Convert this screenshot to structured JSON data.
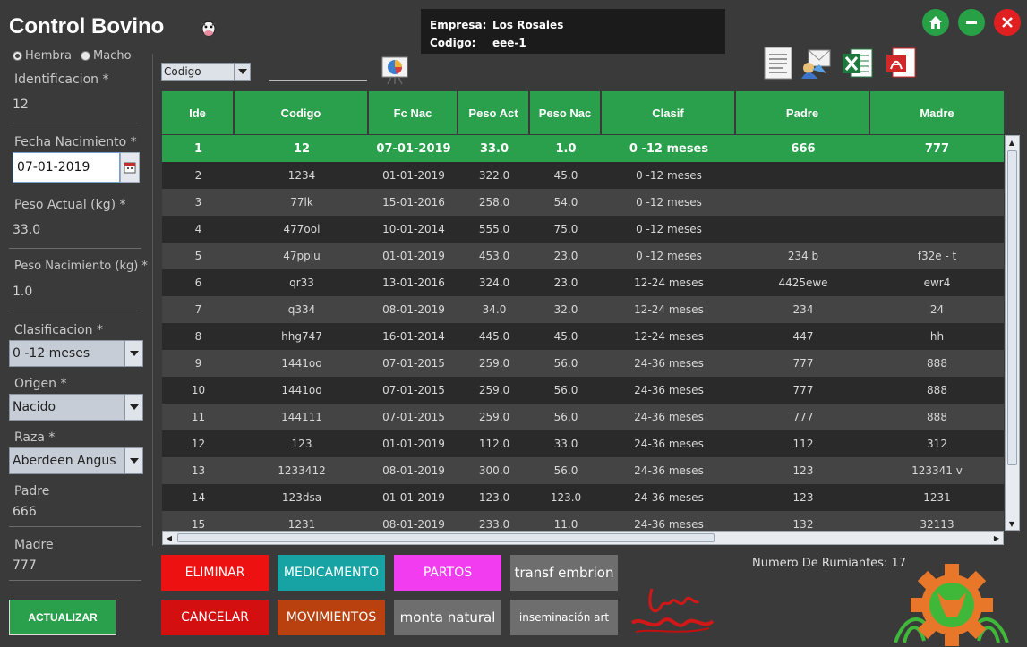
{
  "app": {
    "title": "Control Bovino"
  },
  "company": {
    "empresa_label": "Empresa:",
    "empresa_value": "Los Rosales",
    "codigo_label": "Codigo:",
    "codigo_value": "eee-1"
  },
  "form": {
    "sex_hembra": "Hembra",
    "sex_macho": "Macho",
    "identificacion_label": "Identificacion *",
    "identificacion_value": "12",
    "fecha_label": "Fecha Nacimiento *",
    "fecha_value": "07-01-2019",
    "peso_actual_label": "Peso Actual (kg) *",
    "peso_actual_value": "33.0",
    "peso_nac_label": "Peso Nacimiento (kg) *",
    "peso_nac_value": "1.0",
    "clasificacion_label": "Clasificacion *",
    "clasificacion_value": "0 -12 meses",
    "origen_label": "Origen *",
    "origen_value": "Nacido",
    "raza_label": "Raza *",
    "raza_value": "Aberdeen Angus",
    "padre_label": "Padre",
    "padre_value": "666",
    "madre_label": "Madre",
    "madre_value": "777",
    "update_button": "ACTUALIZAR"
  },
  "filter": {
    "field": "Codigo"
  },
  "table": {
    "columns": [
      "Ide",
      "Codigo",
      "Fc Nac",
      "Peso Act",
      "Peso Nac",
      "Clasif",
      "Padre",
      "Madre"
    ],
    "rows": [
      [
        "1",
        "12",
        "07-01-2019",
        "33.0",
        "1.0",
        "0 -12 meses",
        "666",
        "777"
      ],
      [
        "2",
        "1234",
        "01-01-2019",
        "322.0",
        "45.0",
        "0 -12 meses",
        "",
        ""
      ],
      [
        "3",
        "77lk",
        "15-01-2016",
        "258.0",
        "54.0",
        "0 -12 meses",
        "",
        ""
      ],
      [
        "4",
        "477ooi",
        "10-01-2014",
        "555.0",
        "75.0",
        "0 -12 meses",
        "",
        ""
      ],
      [
        "5",
        "47ppiu",
        "01-01-2019",
        "453.0",
        "23.0",
        "0 -12 meses",
        "234 b",
        "f32e - t"
      ],
      [
        "6",
        "qr33",
        "13-01-2016",
        "324.0",
        "23.0",
        "12-24 meses",
        "4425ewe",
        "ewr4"
      ],
      [
        "7",
        "q334",
        "08-01-2019",
        "34.0",
        "32.0",
        "12-24 meses",
        "234",
        "24"
      ],
      [
        "8",
        "hhg747",
        "16-01-2014",
        "445.0",
        "45.0",
        "12-24 meses",
        "447",
        "hh"
      ],
      [
        "9",
        "1441oo",
        "07-01-2015",
        "259.0",
        "56.0",
        "24-36 meses",
        "777",
        "888"
      ],
      [
        "10",
        "1441oo",
        "07-01-2015",
        "259.0",
        "56.0",
        "24-36 meses",
        "777",
        "888"
      ],
      [
        "11",
        "144111",
        "07-01-2015",
        "259.0",
        "56.0",
        "24-36 meses",
        "777",
        "888"
      ],
      [
        "12",
        "123",
        "01-01-2019",
        "112.0",
        "33.0",
        "24-36 meses",
        "112",
        "312"
      ],
      [
        "13",
        "1233412",
        "08-01-2019",
        "300.0",
        "56.0",
        "24-36 meses",
        "123",
        "123341 v"
      ],
      [
        "14",
        "123dsa",
        "01-01-2019",
        "123.0",
        "123.0",
        "24-36 meses",
        "123",
        "1231"
      ],
      [
        "15",
        "1231",
        "08-01-2019",
        "233.0",
        "11.0",
        "24-36 meses",
        "132",
        "32113"
      ]
    ],
    "selected_row": 0
  },
  "actions": {
    "eliminar": "ELIMINAR",
    "medicamento": "MEDICAMENTO",
    "partos": "PARTOS",
    "transf_embrion": "transf embrion",
    "cancelar": "CANCELAR",
    "movimientos": "MOVIMIENTOS",
    "monta_natural": "monta natural",
    "inseminacion_art": "inseminación art"
  },
  "status": {
    "count_label": "Numero De Rumiantes:",
    "count_value": "17"
  },
  "icons": [
    "cow-icon",
    "home-icon",
    "minimize-icon",
    "close-icon",
    "report-icon",
    "email-icon",
    "excel-icon",
    "pdf-icon",
    "chart-icon",
    "calendar-icon",
    "logo-icon"
  ],
  "colors": {
    "background": "#3a3a3a",
    "accent_green": "#2aa04c",
    "close_red": "#e02020",
    "eliminar": "#ee1111",
    "cancelar": "#d40f0f",
    "medicamento": "#17a3a3",
    "partos": "#f23cf0",
    "movimientos": "#b8410f",
    "gray_button": "#6e6e6e"
  }
}
